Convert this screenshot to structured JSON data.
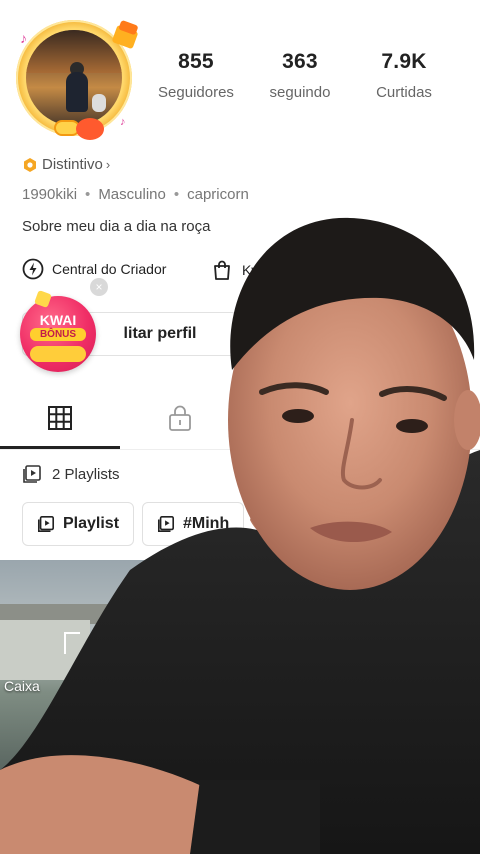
{
  "profile": {
    "stats": [
      {
        "value": "855",
        "label": "Seguidores"
      },
      {
        "value": "363",
        "label": "seguindo"
      },
      {
        "value": "7.9K",
        "label": "Curtidas"
      }
    ],
    "badge_label": "Distintivo",
    "badge_chevron": "›",
    "meta": {
      "username": "1990kiki",
      "gender": "Masculino",
      "sign": "capricorn",
      "separator": "•"
    },
    "bio": "Sobre meu dia a dia na roça",
    "shortcuts": [
      {
        "label": "Central do Criador",
        "icon": "lightning-icon"
      },
      {
        "label": "Kw",
        "icon": "shopping-bag-icon"
      }
    ],
    "edit_button": "litar perfil"
  },
  "kwai_bonus": {
    "line1": "KWAI",
    "line2": "BÔNUS",
    "close": "×"
  },
  "tabs": [
    {
      "icon": "grid-icon",
      "active": true
    },
    {
      "icon": "lock-icon",
      "active": false
    }
  ],
  "playlists": {
    "count_label": "2 Playlists",
    "chips": [
      {
        "label": "Playlist",
        "icon": "playlist-icon"
      },
      {
        "label": "#Minh",
        "icon": "playlist-icon"
      }
    ]
  },
  "videos": [
    {
      "caption": "Caixa"
    }
  ],
  "colors": {
    "accent_bonus": "#f02e66",
    "badge_gold": "#f5a623",
    "text_primary": "#222222",
    "text_secondary": "#777777"
  }
}
